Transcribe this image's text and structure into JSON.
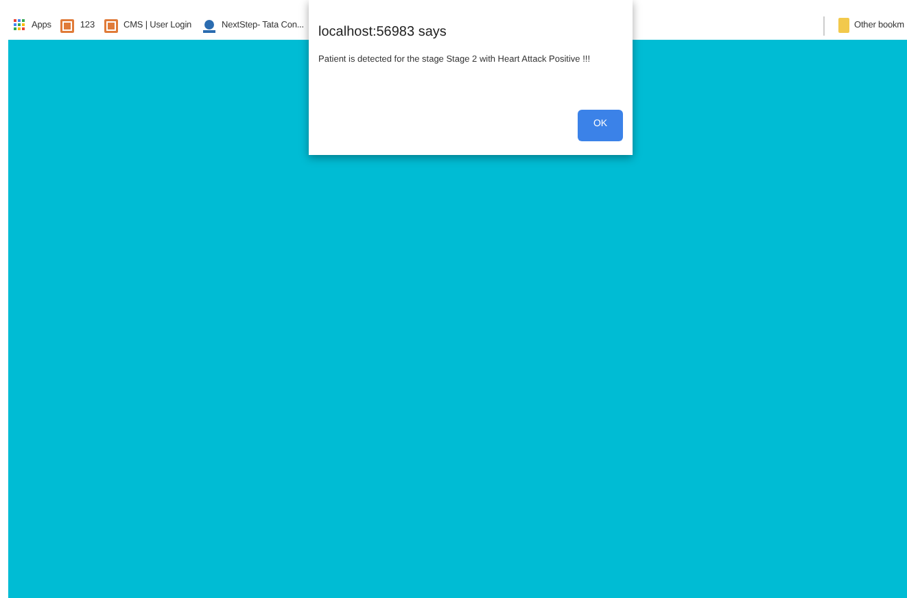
{
  "bookmarks_bar": {
    "items": [
      {
        "label": "Apps",
        "kind": "apps"
      },
      {
        "label": "123",
        "kind": "page"
      },
      {
        "label": "CMS | User Login",
        "kind": "page"
      },
      {
        "label": "NextStep- Tata Con...",
        "kind": "site"
      }
    ],
    "other": {
      "label": "Other bookm",
      "kind": "folder"
    }
  },
  "dialog": {
    "title": "localhost:56983 says",
    "message": "Patient is detected for the stage Stage 2 with Heart Attack Positive !!!",
    "buttons": [
      "OK"
    ]
  }
}
